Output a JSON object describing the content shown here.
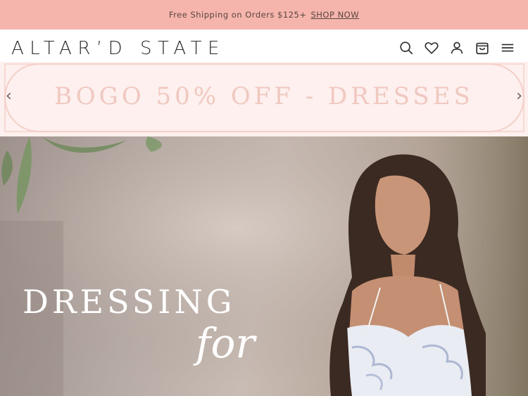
{
  "promo": {
    "text": "Free Shipping on Orders $125+",
    "link": "SHOP NOW"
  },
  "header": {
    "logo": "ALTAR’D STATE",
    "icons": [
      "search-icon",
      "heart-icon",
      "account-icon",
      "bag-icon",
      "menu-icon"
    ]
  },
  "banner": {
    "text": "BOGO 50% OFF - DRESSES",
    "prev": "‹",
    "next": "›"
  },
  "hero": {
    "title": "DRESSING",
    "script": "for"
  },
  "colors": {
    "promo_bg": "#f5b5ac",
    "banner_bg": "#fdf0ee",
    "banner_text": "#f0c8c0",
    "logo": "#2b2b2b"
  }
}
